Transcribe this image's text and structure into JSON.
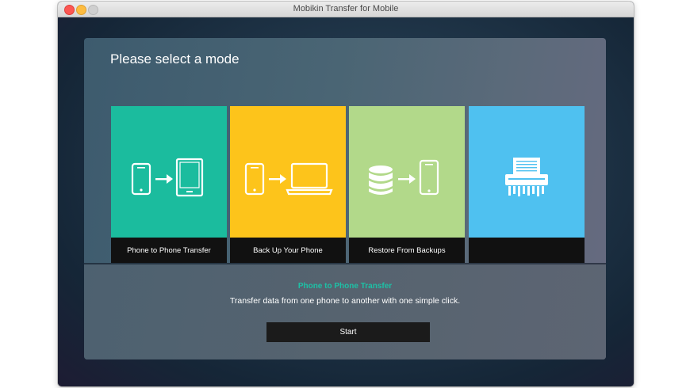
{
  "window": {
    "title": "Mobikin Transfer for Mobile"
  },
  "main": {
    "heading": "Please select a mode",
    "modes": [
      {
        "label": "Phone to Phone Transfer",
        "color": "#1bbc9e",
        "icon": "phone-to-tablet-icon",
        "selected": true
      },
      {
        "label": "Back Up Your Phone",
        "color": "#fdc41b",
        "icon": "phone-to-laptop-icon",
        "selected": false
      },
      {
        "label": "Restore From Backups",
        "color": "#b2d98a",
        "icon": "database-to-phone-icon",
        "selected": false
      },
      {
        "label": "",
        "color": "#4fc1f0",
        "icon": "shredder-icon",
        "selected": false
      }
    ],
    "selected_mode": {
      "title": "Phone to Phone Transfer",
      "description": "Transfer data from one phone to another with one simple click."
    },
    "start_label": "Start"
  },
  "colors": {
    "accent": "#1dc1a6"
  }
}
